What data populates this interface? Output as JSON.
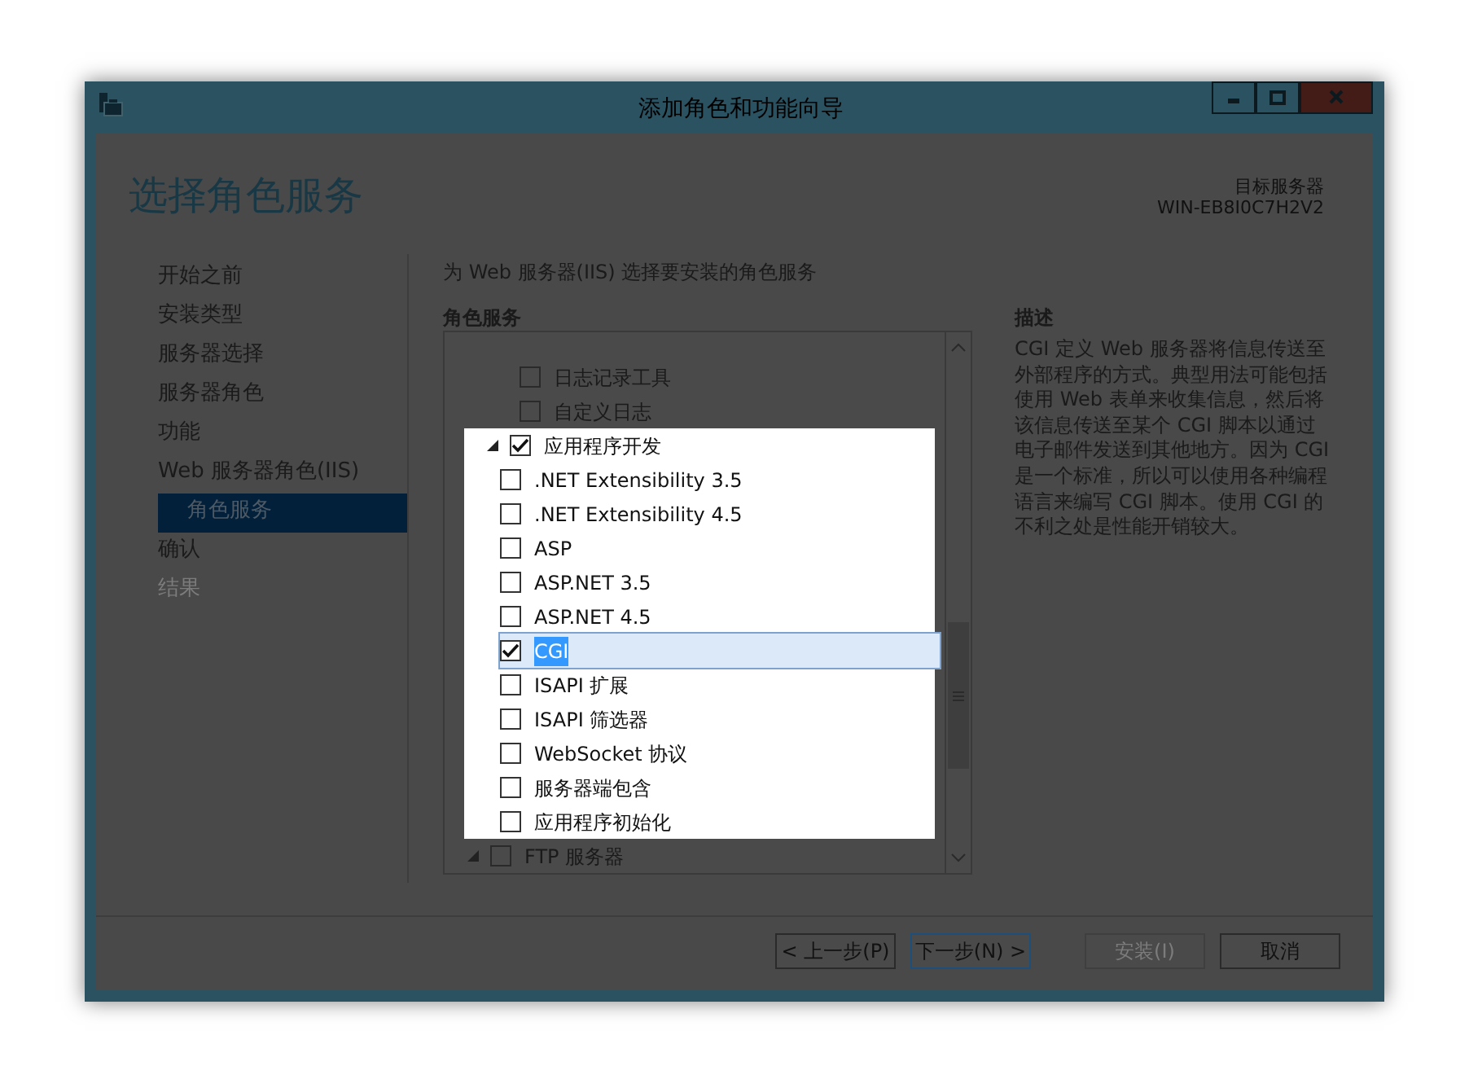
{
  "window": {
    "title": "添加角色和功能向导",
    "controls": [
      {
        "kind": "minimize"
      },
      {
        "kind": "maximize"
      },
      {
        "kind": "close"
      }
    ]
  },
  "header": {
    "title": "选择角色服务",
    "target_label": "目标服务器",
    "target_server": "WIN-EB8I0C7H2V2"
  },
  "nav": [
    {
      "label": "开始之前",
      "selected": false,
      "disabled": false
    },
    {
      "label": "安装类型",
      "selected": false,
      "disabled": false
    },
    {
      "label": "服务器选择",
      "selected": false,
      "disabled": false
    },
    {
      "label": "服务器角色",
      "selected": false,
      "disabled": false
    },
    {
      "label": "功能",
      "selected": false,
      "disabled": false
    },
    {
      "label": "Web 服务器角色(IIS)",
      "selected": false,
      "disabled": false
    },
    {
      "label": "角色服务",
      "selected": true,
      "disabled": false
    },
    {
      "label": "确认",
      "selected": false,
      "disabled": false
    },
    {
      "label": "结果",
      "selected": false,
      "disabled": true
    }
  ],
  "instruction": "为 Web 服务器(IIS) 选择要安装的角色服务",
  "section_label": "角色服务",
  "tree": [
    {
      "children": [
        {
          "label": "日志记录工具",
          "checked": false,
          "selected": false
        },
        {
          "label": "自定义日志",
          "checked": false,
          "selected": false
        }
      ]
    },
    {
      "label": "应用程序开发",
      "checked": true,
      "selected": false,
      "expanded": true,
      "highlighted": true,
      "children": [
        {
          "label": ".NET Extensibility 3.5",
          "checked": false,
          "selected": false
        },
        {
          "label": ".NET Extensibility 4.5",
          "checked": false,
          "selected": false
        },
        {
          "label": "ASP",
          "checked": false,
          "selected": false
        },
        {
          "label": "ASP.NET 3.5",
          "checked": false,
          "selected": false
        },
        {
          "label": "ASP.NET 4.5",
          "checked": false,
          "selected": false
        },
        {
          "label": "CGI",
          "checked": true,
          "selected": true
        },
        {
          "label": "ISAPI 扩展",
          "checked": false,
          "selected": false
        },
        {
          "label": "ISAPI 筛选器",
          "checked": false,
          "selected": false
        },
        {
          "label": "WebSocket 协议",
          "checked": false,
          "selected": false
        },
        {
          "label": "服务器端包含",
          "checked": false,
          "selected": false
        },
        {
          "label": "应用程序初始化",
          "checked": false,
          "selected": false
        }
      ]
    },
    {
      "label": "FTP 服务器",
      "checked": false,
      "selected": false,
      "expanded": true,
      "highlighted": false
    }
  ],
  "description": {
    "heading": "描述",
    "text": "CGI 定义 Web 服务器将信息传送至外部程序的方式。典型用法可能包括使用 Web 表单来收集信息，然后将该信息传送至某个 CGI 脚本以通过电子邮件发送到其他地方。因为 CGI 是一个标准，所以可以使用各种编程语言来编写 CGI 脚本。使用 CGI 的不利之处是性能开销较大。"
  },
  "buttons": [
    {
      "label": "< 上一步(P)",
      "disabled": false,
      "default": false
    },
    {
      "label": "下一步(N) >",
      "disabled": false,
      "default": true
    },
    {
      "label": "安装(I)",
      "disabled": true,
      "default": false
    },
    {
      "label": "取消",
      "disabled": false,
      "default": false
    }
  ]
}
